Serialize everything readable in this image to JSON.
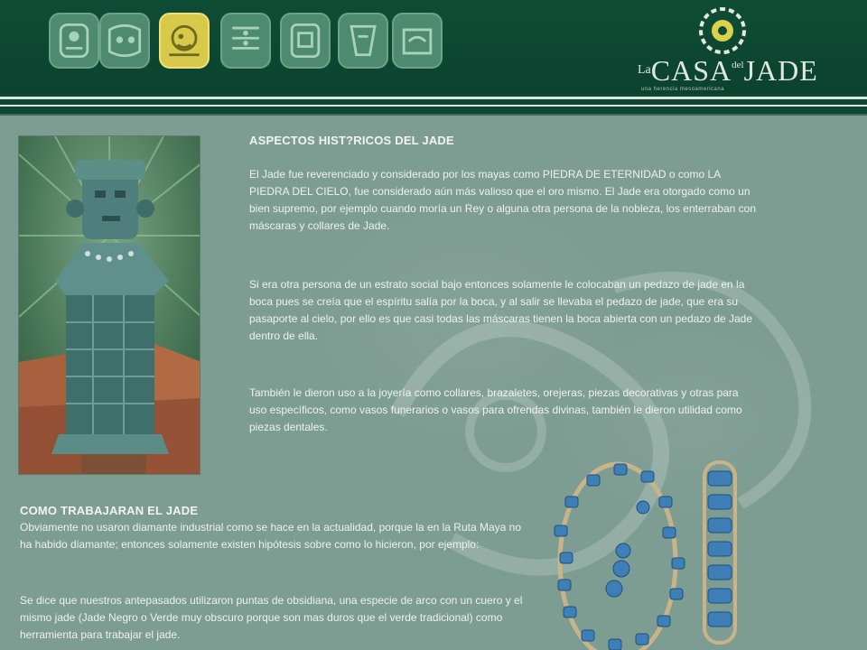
{
  "header": {
    "glyph_tabs": [
      {
        "icon": "maya-glyph-1-icon",
        "active": false
      },
      {
        "icon": "maya-glyph-2-icon",
        "active": false
      },
      {
        "icon": "maya-glyph-3-icon",
        "active": true
      },
      {
        "icon": "maya-glyph-4-icon",
        "active": false
      },
      {
        "icon": "maya-glyph-5-icon",
        "active": false
      },
      {
        "icon": "maya-glyph-6-icon",
        "active": false
      },
      {
        "icon": "maya-glyph-7-icon",
        "active": false
      }
    ],
    "logo": {
      "la": "La",
      "casa": "CASA",
      "del": "del",
      "jade": "JADE",
      "tagline": "una herencia mesoamericana"
    }
  },
  "main": {
    "section1": {
      "title": "ASPECTOS HIST?RICOS DEL JADE",
      "paragraphs": [
        "El Jade fue reverenciado y considerado por los mayas como PIEDRA DE ETERNIDAD o como LA PIEDRA DEL CIELO, fue considerado aún más valioso que el oro mismo. El Jade era otorgado como un bien supremo, por ejemplo cuando moría un Rey o alguna otra persona de la nobleza, los enterraban con máscaras y collares de Jade.",
        "Si era otra persona de un estrato social bajo entonces solamente le colocaban un pedazo de jade en la boca pues se creía que el espíritu salía por la boca, y al salir se llevaba el pedazo de jade, que era su pasaporte al cielo, por ello es que casi todas las máscaras tienen la boca abierta con un pedazo de Jade dentro de ella.",
        "También le dieron uso a la joyería como collares, brazaletes, orejeras, piezas decorativas y otras para uso específicos, como vasos funerarios o vasos para ofrendas divinas, también le dieron utilidad como piezas dentales."
      ]
    },
    "section2": {
      "title": "COMO TRABAJARAN EL JADE",
      "paragraphs": [
        "Obviamente no usaron diamante industrial como se hace en la actualidad, porque la en la Ruta Maya no ha habido diamante; entonces solamente existen hipótesis sobre como lo hicieron, por ejemplo:",
        "Se dice que nuestros antepasados utilizaron puntas de obsidiana, una especie de arco con un cuero y el mismo jade (Jade Negro o Verde muy obscuro porque son mas duros que el verde tradicional) como herramienta para trabajar el jade."
      ]
    },
    "images": {
      "statue": "jade-mask-statue",
      "jewelry": "jade-necklace-bracelet-earrings"
    }
  },
  "colors": {
    "header_bg": "#0f4c35",
    "content_bg": "#7d9c92",
    "active_tab": "#d9c94a",
    "tab": "#4d8a6f",
    "jade_blue": "#3f7fb8"
  }
}
